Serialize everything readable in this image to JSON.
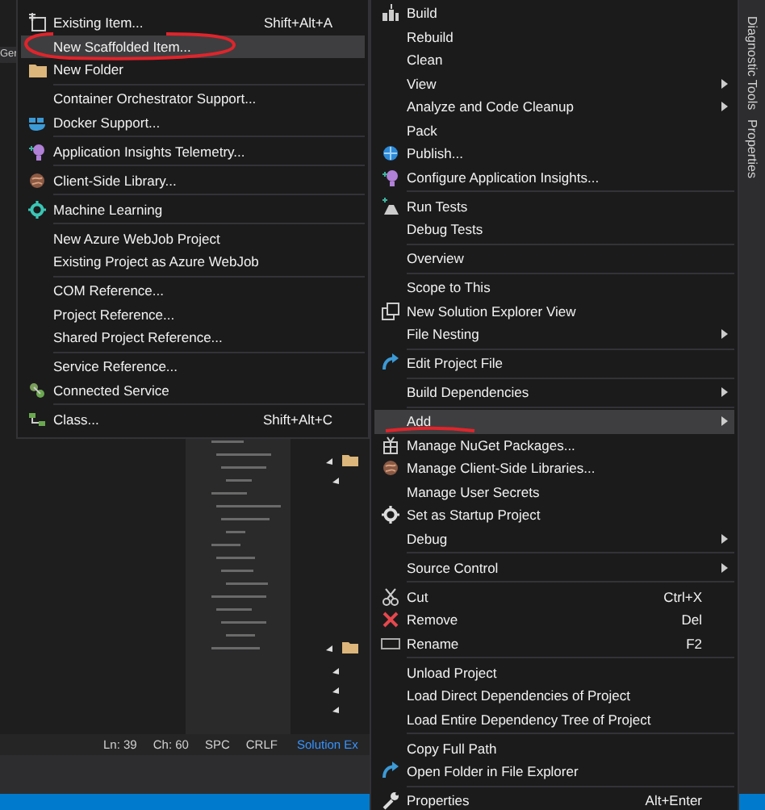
{
  "background": {
    "tab_label": "Ger",
    "status_bar": [
      "Ln: 39",
      "Ch: 60",
      "SPC",
      "CRLF"
    ],
    "panel_tab": "Solution Ex"
  },
  "side_tabs": [
    "Diagnostic Tools",
    "Properties"
  ],
  "add_menu": {
    "groups": [
      {
        "items": [
          {
            "label": "Existing Item...",
            "shortcut": "Shift+Alt+A",
            "selected": false
          },
          {
            "label": "New Scaffolded Item...",
            "selected": true
          },
          {
            "label": "New Folder",
            "selected": false
          }
        ]
      },
      {
        "items": [
          {
            "label": "Container Orchestrator Support...",
            "selected": false
          },
          {
            "label": "Docker Support...",
            "selected": false
          }
        ]
      },
      {
        "items": [
          {
            "label": "Application Insights Telemetry...",
            "selected": false
          }
        ]
      },
      {
        "items": [
          {
            "label": "Client-Side Library...",
            "selected": false
          }
        ]
      },
      {
        "items": [
          {
            "label": "Machine Learning",
            "selected": false
          }
        ]
      },
      {
        "items": [
          {
            "label": "New Azure WebJob Project",
            "selected": false
          },
          {
            "label": "Existing Project as Azure WebJob",
            "selected": false
          }
        ]
      },
      {
        "items": [
          {
            "label": "COM Reference...",
            "selected": false
          },
          {
            "label": "Project Reference...",
            "selected": false
          },
          {
            "label": "Shared Project Reference...",
            "selected": false
          }
        ]
      },
      {
        "items": [
          {
            "label": "Service Reference...",
            "selected": false
          },
          {
            "label": "Connected Service",
            "selected": false
          }
        ]
      },
      {
        "items": [
          {
            "label": "Class...",
            "shortcut": "Shift+Alt+C",
            "selected": false
          }
        ]
      }
    ]
  },
  "context_menu": {
    "groups": [
      {
        "items": [
          {
            "label": "Build",
            "submenu": false,
            "selected": false
          },
          {
            "label": "Rebuild",
            "submenu": false,
            "selected": false
          },
          {
            "label": "Clean",
            "submenu": false,
            "selected": false
          },
          {
            "label": "View",
            "submenu": true,
            "selected": false
          },
          {
            "label": "Analyze and Code Cleanup",
            "submenu": true,
            "selected": false
          },
          {
            "label": "Pack",
            "submenu": false,
            "selected": false
          },
          {
            "label": "Publish...",
            "submenu": false,
            "selected": false
          },
          {
            "label": "Configure Application Insights...",
            "submenu": false,
            "selected": false
          }
        ]
      },
      {
        "items": [
          {
            "label": "Run Tests",
            "submenu": false,
            "selected": false
          },
          {
            "label": "Debug Tests",
            "submenu": false,
            "selected": false
          }
        ]
      },
      {
        "items": [
          {
            "label": "Overview",
            "submenu": false,
            "selected": false
          }
        ]
      },
      {
        "items": [
          {
            "label": "Scope to This",
            "submenu": false,
            "selected": false
          },
          {
            "label": "New Solution Explorer View",
            "submenu": false,
            "selected": false
          },
          {
            "label": "File Nesting",
            "submenu": true,
            "selected": false
          }
        ]
      },
      {
        "items": [
          {
            "label": "Edit Project File",
            "submenu": false,
            "selected": false
          }
        ]
      },
      {
        "items": [
          {
            "label": "Build Dependencies",
            "submenu": true,
            "selected": false
          }
        ]
      },
      {
        "items": [
          {
            "label": "Add",
            "submenu": true,
            "selected": true
          },
          {
            "label": "Manage NuGet Packages...",
            "submenu": false,
            "selected": false
          },
          {
            "label": "Manage Client-Side Libraries...",
            "submenu": false,
            "selected": false
          },
          {
            "label": "Manage User Secrets",
            "submenu": false,
            "selected": false
          },
          {
            "label": "Set as Startup Project",
            "submenu": false,
            "selected": false
          },
          {
            "label": "Debug",
            "submenu": true,
            "selected": false
          }
        ]
      },
      {
        "items": [
          {
            "label": "Source Control",
            "submenu": true,
            "selected": false
          }
        ]
      },
      {
        "items": [
          {
            "label": "Cut",
            "shortcut": "Ctrl+X",
            "submenu": false,
            "selected": false
          },
          {
            "label": "Remove",
            "shortcut": "Del",
            "submenu": false,
            "selected": false
          },
          {
            "label": "Rename",
            "shortcut": "F2",
            "submenu": false,
            "selected": false
          }
        ]
      },
      {
        "items": [
          {
            "label": "Unload Project",
            "submenu": false,
            "selected": false
          },
          {
            "label": "Load Direct Dependencies of Project",
            "submenu": false,
            "selected": false
          },
          {
            "label": "Load Entire Dependency Tree of Project",
            "submenu": false,
            "selected": false
          }
        ]
      },
      {
        "items": [
          {
            "label": "Copy Full Path",
            "submenu": false,
            "selected": false
          },
          {
            "label": "Open Folder in File Explorer",
            "submenu": false,
            "selected": false
          }
        ]
      },
      {
        "items": [
          {
            "label": "Properties",
            "shortcut": "Alt+Enter",
            "submenu": false,
            "selected": false
          }
        ]
      }
    ]
  }
}
